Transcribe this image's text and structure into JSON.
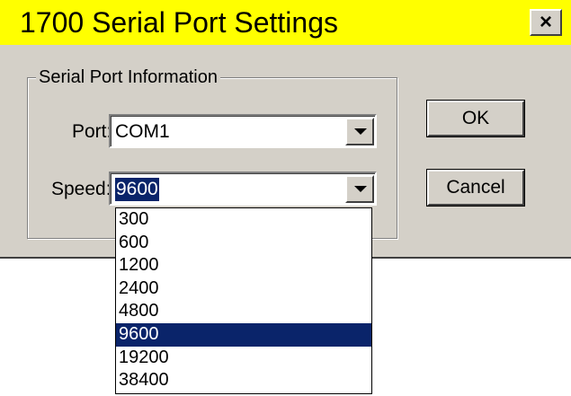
{
  "window": {
    "title": "1700 Serial Port Settings",
    "close_label": "×",
    "title_bar_color": "#ffff00"
  },
  "group": {
    "legend": "Serial Port Information"
  },
  "port": {
    "label": "Port:",
    "value": "COM1"
  },
  "speed": {
    "label": "Speed:",
    "value": "9600",
    "options": [
      "300",
      "600",
      "1200",
      "2400",
      "4800",
      "9600",
      "19200",
      "38400"
    ],
    "highlighted_option": "9600"
  },
  "buttons": {
    "ok_label": "OK",
    "cancel_label": "Cancel"
  },
  "colors": {
    "dialog_face": "#d4d0c8",
    "selection": "#0a246a"
  },
  "icons": {
    "close": "close-icon",
    "dropdown": "chevron-down-icon"
  }
}
